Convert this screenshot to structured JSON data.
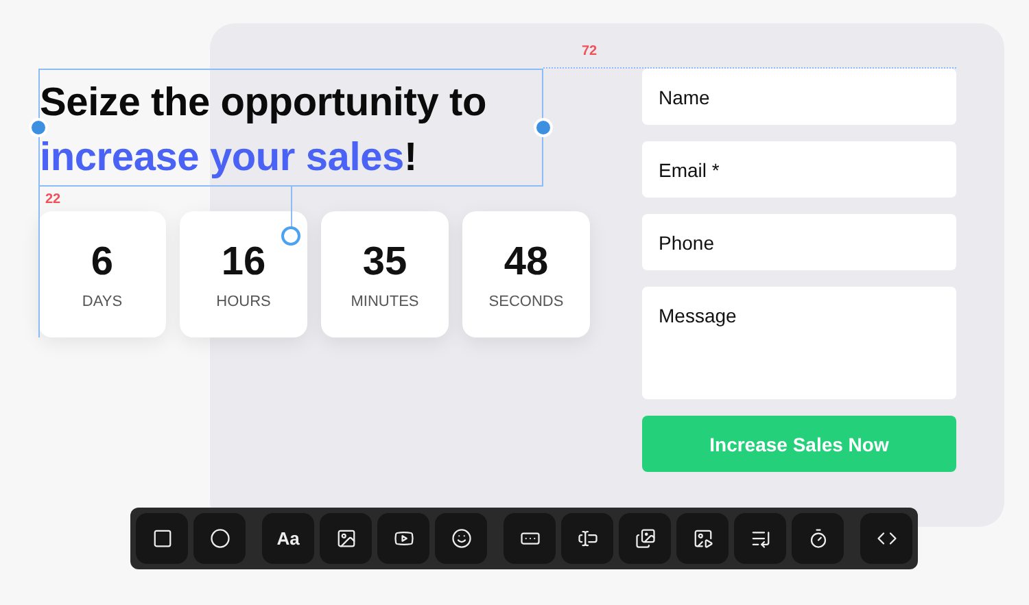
{
  "heading": {
    "start": "Seize the opportunity to ",
    "highlight": "increase your sales",
    "end": "!"
  },
  "selection": {
    "top_gap": "72",
    "bottom_gap": "22"
  },
  "countdown": [
    {
      "value": "6",
      "unit": "DAYS"
    },
    {
      "value": "16",
      "unit": "HOURS"
    },
    {
      "value": "35",
      "unit": "MINUTES"
    },
    {
      "value": "48",
      "unit": "SECONDS"
    }
  ],
  "form": {
    "fields": [
      {
        "kind": "input",
        "placeholder": "Name"
      },
      {
        "kind": "input",
        "placeholder": "Email *"
      },
      {
        "kind": "input",
        "placeholder": "Phone"
      },
      {
        "kind": "textarea",
        "placeholder": "Message"
      }
    ],
    "submit": "Increase Sales Now"
  },
  "toolbar": [
    [
      {
        "kind": "square"
      },
      {
        "kind": "circle"
      }
    ],
    [
      {
        "kind": "text",
        "label": "Aa"
      },
      {
        "kind": "image"
      },
      {
        "kind": "video"
      },
      {
        "kind": "emoji"
      }
    ],
    [
      {
        "kind": "button"
      },
      {
        "kind": "input"
      },
      {
        "kind": "gallery"
      },
      {
        "kind": "animated-image"
      },
      {
        "kind": "list"
      },
      {
        "kind": "timer"
      }
    ],
    [
      {
        "kind": "code"
      }
    ]
  ]
}
